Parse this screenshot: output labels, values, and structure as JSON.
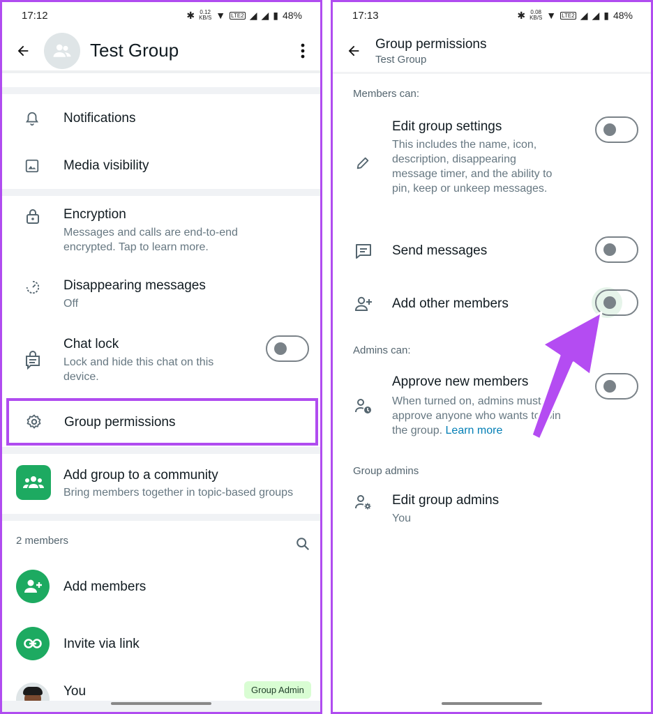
{
  "left": {
    "status": {
      "time": "17:12",
      "speed": "0.12",
      "speed_unit": "KB/S",
      "lte": "LTE2",
      "battery": "48%"
    },
    "header": {
      "title": "Test Group"
    },
    "items": {
      "notifications": "Notifications",
      "media_visibility": "Media visibility",
      "encryption": {
        "title": "Encryption",
        "sub": "Messages and calls are end-to-end encrypted. Tap to learn more."
      },
      "disappearing": {
        "title": "Disappearing messages",
        "sub": "Off"
      },
      "chat_lock": {
        "title": "Chat lock",
        "sub": "Lock and hide this chat on this device.",
        "enabled": false
      },
      "group_permissions": "Group permissions",
      "community": {
        "title": "Add group to a community",
        "sub": "Bring members together in topic-based groups"
      }
    },
    "members": {
      "count_label": "2 members",
      "add_members": "Add members",
      "invite_link": "Invite via link",
      "you": "You",
      "admin_badge": "Group Admin"
    }
  },
  "right": {
    "status": {
      "time": "17:13",
      "speed": "0.08",
      "speed_unit": "KB/S",
      "lte": "LTE2",
      "battery": "48%"
    },
    "header": {
      "title": "Group permissions",
      "subtitle": "Test Group"
    },
    "members_can": "Members can:",
    "edit_settings": {
      "title": "Edit group settings",
      "sub": "This includes the name, icon, description, disappearing message timer, and the ability to pin, keep or unkeep messages.",
      "enabled": false
    },
    "send_messages": {
      "title": "Send messages",
      "enabled": false
    },
    "add_members": {
      "title": "Add other members",
      "enabled": false
    },
    "admins_can": "Admins can:",
    "approve": {
      "title": "Approve new members",
      "sub": "When turned on, admins must approve anyone who wants to join the group.",
      "link": "Learn more",
      "enabled": false
    },
    "group_admins_h": "Group admins",
    "edit_admins": {
      "title": "Edit group admins",
      "sub": "You"
    }
  },
  "colors": {
    "accent_border": "#b04cf0",
    "arrow": "#b44cf2",
    "whatsapp_green": "#1daa61",
    "link": "#027eb5"
  }
}
